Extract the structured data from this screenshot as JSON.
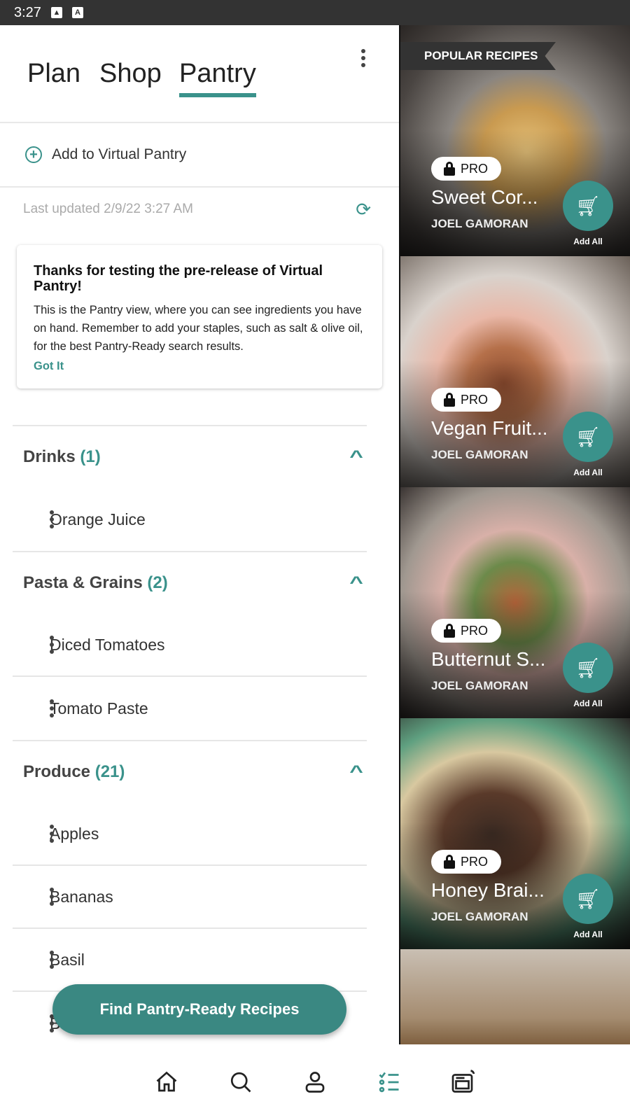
{
  "status_bar": {
    "time": "3:27",
    "icons": [
      "image-icon",
      "font-icon"
    ]
  },
  "tabs": [
    {
      "label": "Plan",
      "active": false
    },
    {
      "label": "Shop",
      "active": false
    },
    {
      "label": "Pantry",
      "active": true
    }
  ],
  "add_pantry_label": "Add to Virtual Pantry",
  "last_updated": "Last updated 2/9/22 3:27 AM",
  "notice": {
    "title": "Thanks for testing the pre-release of Virtual Pantry!",
    "body": "This is the Pantry view, where you can see ingredients you have on hand. Remember to add your staples, such as salt & olive oil, for the best Pantry-Ready search results.",
    "action": "Got It"
  },
  "sections": [
    {
      "name": "Drinks",
      "count": "(1)",
      "items": [
        "Orange Juice"
      ]
    },
    {
      "name": "Pasta & Grains",
      "count": "(2)",
      "items": [
        "Diced Tomatoes",
        "Tomato Paste"
      ]
    },
    {
      "name": "Produce",
      "count": "(21)",
      "items": [
        "Apples",
        "Bananas",
        "Basil",
        "Bay Leaves"
      ]
    }
  ],
  "fab_label": "Find Pantry-Ready Recipes",
  "popular": {
    "label": "POPULAR RECIPES",
    "recipes": [
      {
        "title": "Sweet Cor...",
        "author": "JOEL GAMORAN",
        "badge": "PRO",
        "add_label": "Add All"
      },
      {
        "title": "Vegan Fruit...",
        "author": "JOEL GAMORAN",
        "badge": "PRO",
        "add_label": "Add All"
      },
      {
        "title": "Butternut S...",
        "author": "JOEL GAMORAN",
        "badge": "PRO",
        "add_label": "Add All"
      },
      {
        "title": "Honey Brai...",
        "author": "JOEL GAMORAN",
        "badge": "PRO",
        "add_label": "Add All"
      }
    ]
  },
  "bottom_nav": [
    "home-icon",
    "search-icon",
    "profile-icon",
    "pantry-list-icon",
    "oven-icon"
  ],
  "colors": {
    "accent": "#3a928b",
    "status_bar": "#333333"
  }
}
